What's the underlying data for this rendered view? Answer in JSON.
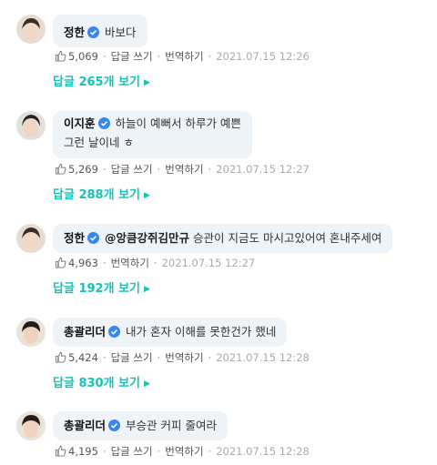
{
  "colors": {
    "accent": "#12c3b6",
    "verified": "#3a86f0",
    "bubble": "#eef3f8"
  },
  "icons": {
    "verified": "verified-check-icon",
    "like": "thumbs-up-icon",
    "more": "triangle-right-icon"
  },
  "comments": [
    {
      "author": "정한",
      "mention": "",
      "text": "바보다",
      "text2": "",
      "likes": "5,069",
      "reply_label": "답글 쓰기",
      "translate_label": "번역하기",
      "date": "2021.07.15 12:26",
      "replies_label": "답글 265개 보기"
    },
    {
      "author": "이지훈",
      "mention": "",
      "text": "하늘이 예뻐서 하루가 예쁜",
      "text2": "그런 날이네 ㅎ",
      "likes": "5,269",
      "reply_label": "답글 쓰기",
      "translate_label": "번역하기",
      "date": "2021.07.15 12:27",
      "replies_label": "답글 288개 보기"
    },
    {
      "author": "정한",
      "mention": "@앙큼강쥐김만규",
      "text": "승관이 지금도 마시고있어여 혼내주세여",
      "text2": "",
      "likes": "4,963",
      "reply_label": "",
      "translate_label": "번역하기",
      "date": "2021.07.15 12:27",
      "replies_label": "답글 192개 보기"
    },
    {
      "author": "총괄리더",
      "mention": "",
      "text": "내가 혼자 이해를 못한건가 했네",
      "text2": "",
      "likes": "5,424",
      "reply_label": "답글 쓰기",
      "translate_label": "번역하기",
      "date": "2021.07.15 12:28",
      "replies_label": "답글 830개 보기"
    },
    {
      "author": "총괄리더",
      "mention": "",
      "text": "부승관 커피 줄여라",
      "text2": "",
      "likes": "4,195",
      "reply_label": "답글 쓰기",
      "translate_label": "번역하기",
      "date": "2021.07.15 12:28",
      "replies_label": ""
    }
  ]
}
